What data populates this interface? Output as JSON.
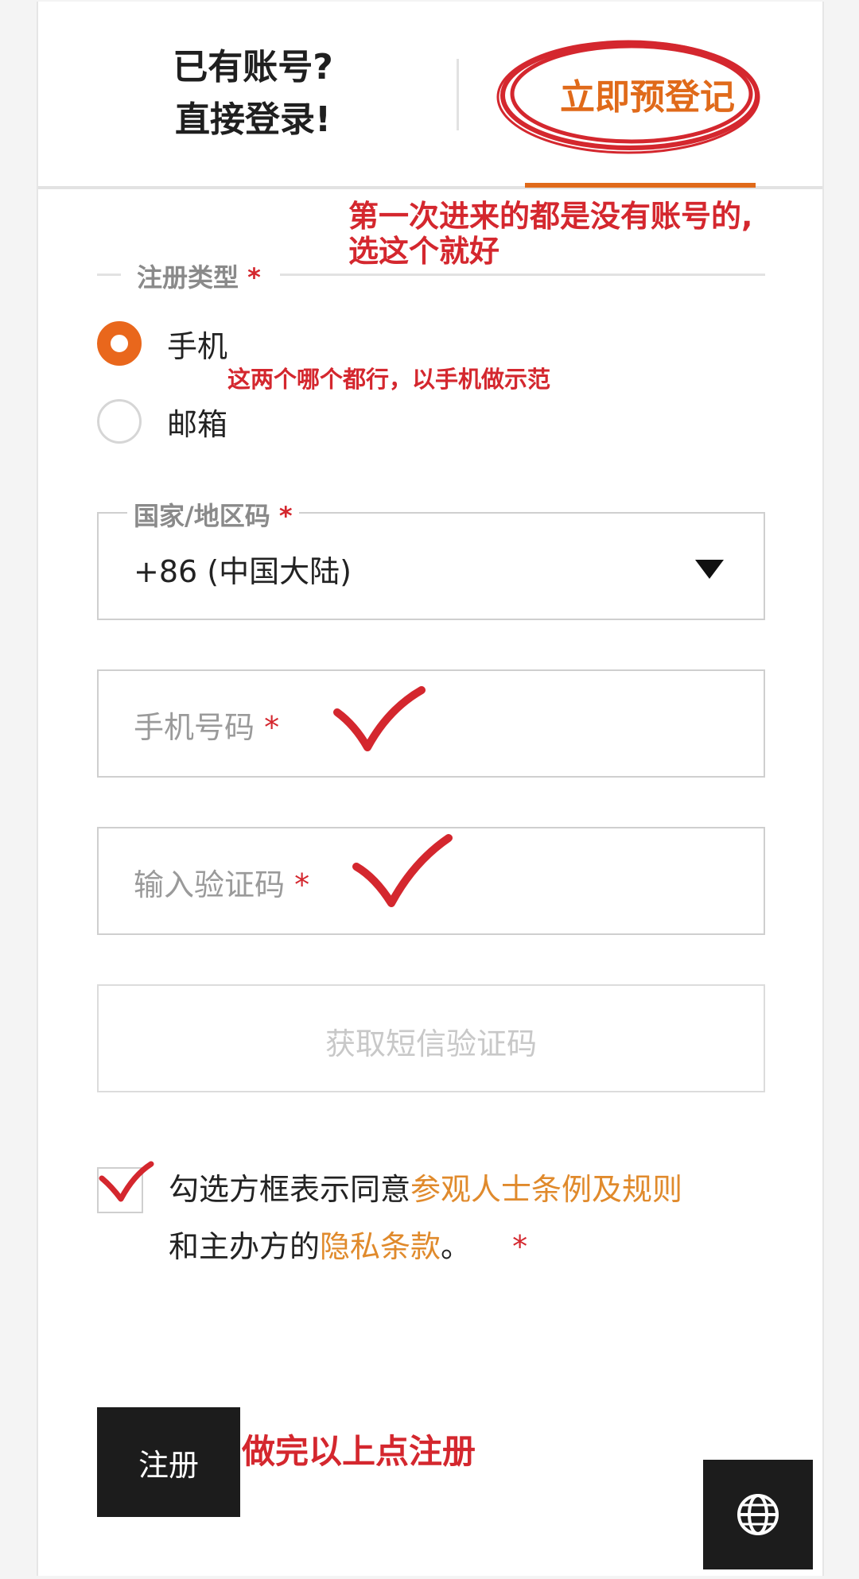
{
  "tabs": {
    "login_line1": "已有账号?",
    "login_line2": "直接登录!",
    "register": "立即预登记"
  },
  "annotations": {
    "first_time_line1": "第一次进来的都是没有账号的,",
    "first_time_line2": "选这个就好",
    "either_ok": "这两个哪个都行，以手机做示范",
    "then_register": "做完以上点注册"
  },
  "register_type": {
    "label": "注册类型",
    "required_mark": "*",
    "options": [
      {
        "label": "手机",
        "selected": true
      },
      {
        "label": "邮箱",
        "selected": false
      }
    ]
  },
  "country_code": {
    "label": "国家/地区码",
    "required_mark": "*",
    "value": "+86 (中国大陆)"
  },
  "phone": {
    "placeholder": "手机号码",
    "required_mark": "*"
  },
  "verify_code": {
    "placeholder": "输入验证码",
    "required_mark": "*"
  },
  "sms_button": "获取短信验证码",
  "agreement": {
    "text1": "勾选方框表示同意",
    "link1": "参观人士条例及规则",
    "text2": "和主办方的",
    "link2": "隐私条款",
    "text3": "。",
    "required_mark": "*",
    "checked": true
  },
  "register_button": "注册",
  "language_icon": "globe-icon",
  "colors": {
    "accent": "#e06a1a",
    "annotation_red": "#d4272e",
    "dark_button": "#1c1c1c"
  }
}
